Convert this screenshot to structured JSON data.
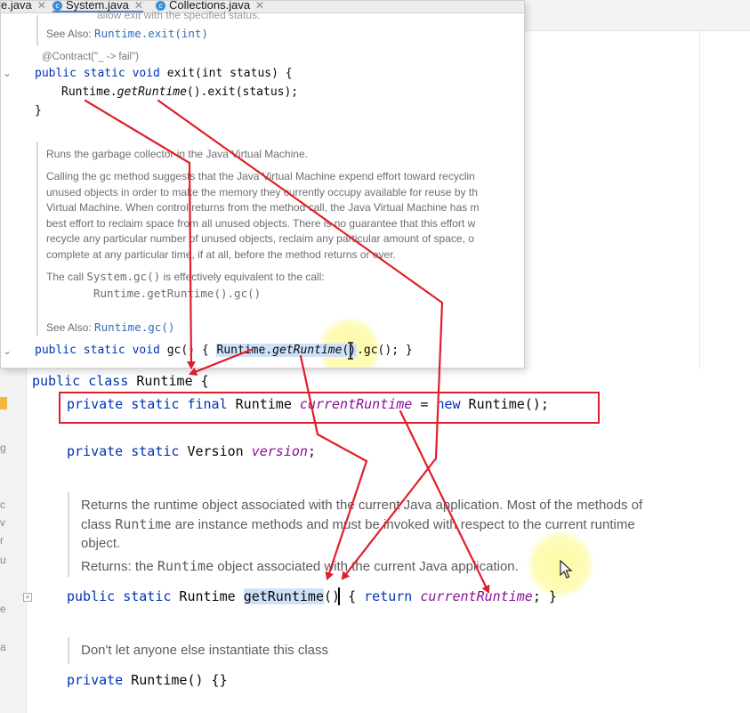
{
  "tabs": [
    {
      "label": "e.java",
      "icon": "java-file-icon"
    },
    {
      "label": "System.java",
      "icon": "java-class-icon"
    },
    {
      "label": "Collections.java",
      "icon": "java-class-icon"
    }
  ],
  "popup": {
    "partial_top_text": "allow exit with the specified status.",
    "see_also_exit": {
      "label": "See Also:",
      "link": "Runtime.exit(int)"
    },
    "contract": "@Contract(\"_ -> fail\")",
    "exit_sig": {
      "kw": "public static void",
      "rest": " exit(int status) {"
    },
    "exit_body": {
      "cls": "Runtime.",
      "method": "getRuntime",
      "rest": "().exit(status);"
    },
    "close_brace": "}",
    "gc_doc": {
      "summary": "Runs the garbage collector in the Java Virtual Machine.",
      "para_lines": [
        "Calling the gc method suggests that the Java Virtual Machine expend effort toward recyclin",
        "unused objects in order to make the memory they currently occupy available for reuse by th",
        "Virtual Machine. When control returns from the method call, the Java Virtual Machine has m",
        "best effort to reclaim space from all unused objects. There is no guarantee that this effort w",
        "recycle any particular number of unused objects, reclaim any particular amount of space, o",
        "complete at any particular time, if at all, before the method returns or ever."
      ],
      "call_pre": "The call ",
      "call_code": "System.gc()",
      "call_post": " is effectively equivalent to the call:",
      "call_equiv": "Runtime.getRuntime().gc()",
      "see_also_label": "See Also:",
      "see_also_link": "Runtime.gc()"
    },
    "gc_sig": {
      "kw": "public static void",
      "name": " gc() { ",
      "cls": "Runtime.",
      "method": "getRuntime",
      "rest_a": "()",
      "rest_b": ".gc(); }"
    }
  },
  "editor": {
    "class_decl": {
      "kw": "public class",
      "name": " Runtime {"
    },
    "field1": {
      "kw": "private static final",
      "type": " Runtime ",
      "name": "currentRuntime",
      "rest": " = ",
      "kw_new": "new",
      "rest2": " Runtime();"
    },
    "field2": {
      "kw": "private static",
      "type": " Version ",
      "name": "version",
      "rest": ";"
    },
    "doc1": {
      "line1": "Returns the runtime object associated with the current Java application. Most of the methods of",
      "line2_pre": "class ",
      "line2_code": "Runtime",
      "line2_post": " are instance methods and must be invoked with respect to the current runtime",
      "line3": "object.",
      "returns_pre": "Returns: the ",
      "returns_code": "Runtime",
      "returns_post": " object associated with the current Java application."
    },
    "getruntime": {
      "kw": "public static",
      "type": " Runtime ",
      "name": "getRuntime",
      "rest": "() { ",
      "kw_return": "return",
      "space": " ",
      "field": "currentRuntime",
      "end": "; }"
    },
    "doc2": "Don't let anyone else instantiate this class",
    "ctor": {
      "kw": "private",
      "name": " Runtime() {}"
    }
  },
  "colors": {
    "keyword": "#0033b3",
    "field": "#871094",
    "annotation": "#e01e2a",
    "link": "#2f6db5",
    "selection": "#cfe1fa"
  }
}
